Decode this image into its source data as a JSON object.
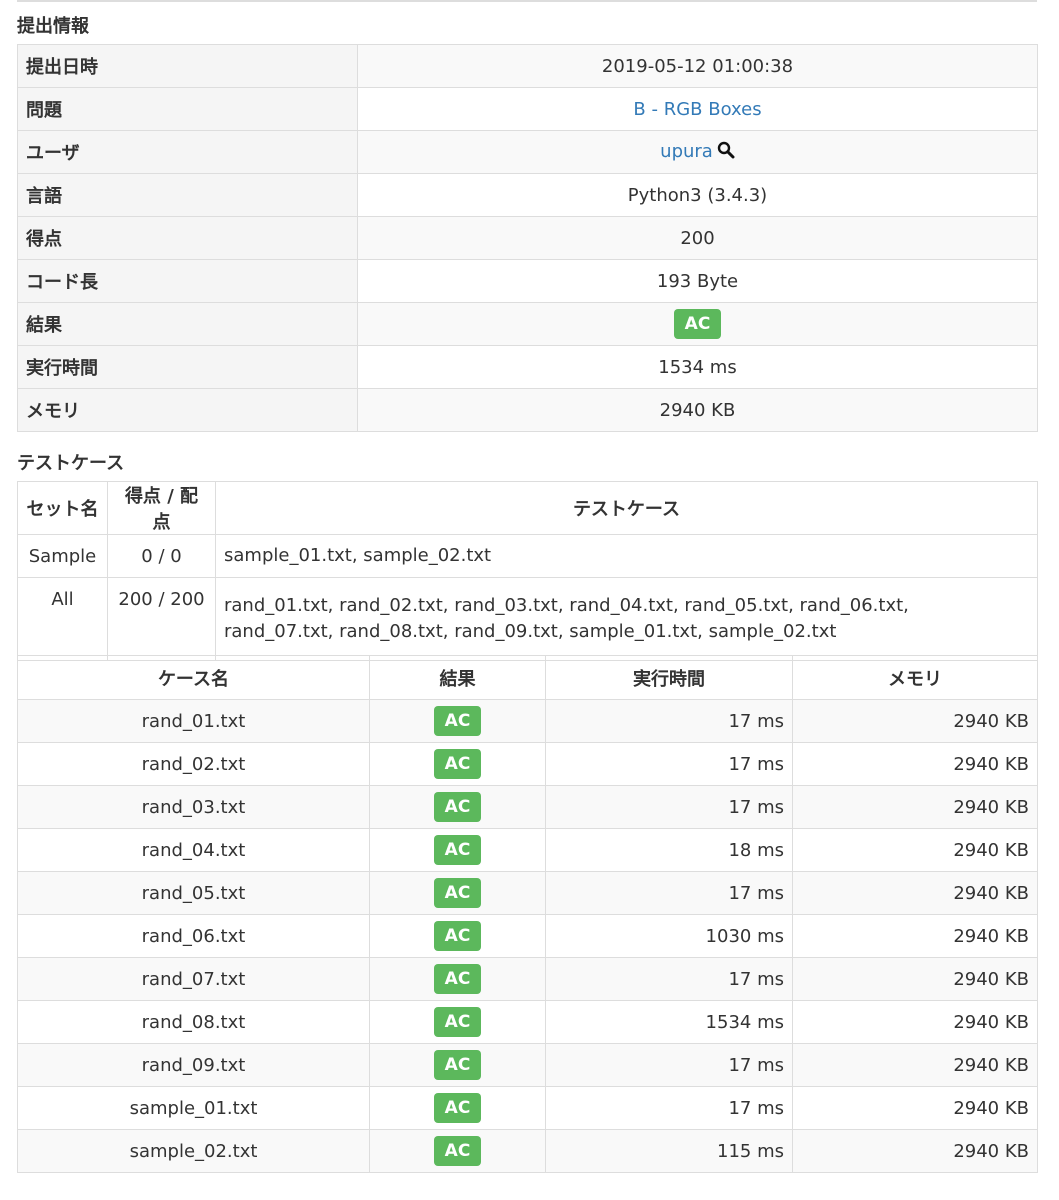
{
  "submission_section": {
    "title": "提出情報",
    "rows": [
      {
        "key": "提出日時",
        "value": "2019-05-12 01:00:38",
        "type": "text"
      },
      {
        "key": "問題",
        "value": "B - RGB Boxes",
        "type": "link"
      },
      {
        "key": "ユーザ",
        "value": "upura",
        "type": "user"
      },
      {
        "key": "言語",
        "value": "Python3 (3.4.3)",
        "type": "text"
      },
      {
        "key": "得点",
        "value": "200",
        "type": "text"
      },
      {
        "key": "コード長",
        "value": "193 Byte",
        "type": "text"
      },
      {
        "key": "結果",
        "value": "AC",
        "type": "badge"
      },
      {
        "key": "実行時間",
        "value": "1534 ms",
        "type": "text"
      },
      {
        "key": "メモリ",
        "value": "2940 KB",
        "type": "text"
      }
    ]
  },
  "testcase_section": {
    "title": "テストケース",
    "headers": {
      "set_name": "セット名",
      "score": "得点 / 配点",
      "cases": "テストケース"
    },
    "sets": [
      {
        "name": "Sample",
        "score": "0 / 0",
        "cases": "sample_01.txt, sample_02.txt"
      },
      {
        "name": "All",
        "score": "200 / 200",
        "cases": "rand_01.txt, rand_02.txt, rand_03.txt, rand_04.txt, rand_05.txt, rand_06.txt, rand_07.txt, rand_08.txt, rand_09.txt, sample_01.txt, sample_02.txt"
      }
    ]
  },
  "case_results": {
    "headers": {
      "name": "ケース名",
      "result": "結果",
      "time": "実行時間",
      "memory": "メモリ"
    },
    "rows": [
      {
        "name": "rand_01.txt",
        "result": "AC",
        "time": "17 ms",
        "memory": "2940 KB"
      },
      {
        "name": "rand_02.txt",
        "result": "AC",
        "time": "17 ms",
        "memory": "2940 KB"
      },
      {
        "name": "rand_03.txt",
        "result": "AC",
        "time": "17 ms",
        "memory": "2940 KB"
      },
      {
        "name": "rand_04.txt",
        "result": "AC",
        "time": "18 ms",
        "memory": "2940 KB"
      },
      {
        "name": "rand_05.txt",
        "result": "AC",
        "time": "17 ms",
        "memory": "2940 KB"
      },
      {
        "name": "rand_06.txt",
        "result": "AC",
        "time": "1030 ms",
        "memory": "2940 KB"
      },
      {
        "name": "rand_07.txt",
        "result": "AC",
        "time": "17 ms",
        "memory": "2940 KB"
      },
      {
        "name": "rand_08.txt",
        "result": "AC",
        "time": "1534 ms",
        "memory": "2940 KB"
      },
      {
        "name": "rand_09.txt",
        "result": "AC",
        "time": "17 ms",
        "memory": "2940 KB"
      },
      {
        "name": "sample_01.txt",
        "result": "AC",
        "time": "17 ms",
        "memory": "2940 KB"
      },
      {
        "name": "sample_02.txt",
        "result": "AC",
        "time": "115 ms",
        "memory": "2940 KB"
      }
    ]
  },
  "colors": {
    "ac_badge": "#5cb85c",
    "link": "#337ab7",
    "border": "#dddddd",
    "key_background": "#f5f5f5"
  },
  "icons": {
    "user_search": "search-icon"
  }
}
